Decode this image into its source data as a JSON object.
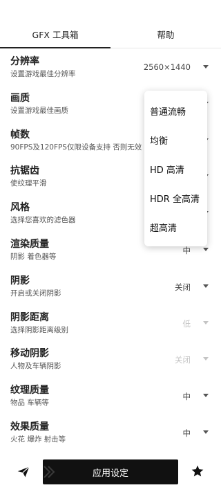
{
  "tabs": [
    {
      "label": "GFX 工具箱",
      "active": true
    },
    {
      "label": "帮助",
      "active": false
    }
  ],
  "settings": [
    {
      "title": "分辨率",
      "desc": "设置游戏最佳分辨率",
      "value": "2560×1440",
      "disabled": false
    },
    {
      "title": "画质",
      "desc": "设置游戏最佳画质",
      "value": "",
      "disabled": false
    },
    {
      "title": "帧数",
      "desc": "90FPS及120FPS仅限设备支持 否则无效",
      "value": "",
      "disabled": false
    },
    {
      "title": "抗锯齿",
      "desc": "使纹理平滑",
      "value": "",
      "disabled": false
    },
    {
      "title": "风格",
      "desc": "选择您喜欢的滤色器",
      "value": "",
      "disabled": false
    },
    {
      "title": "渲染质量",
      "desc": "阴影 着色器等",
      "value": "中",
      "disabled": false
    },
    {
      "title": "阴影",
      "desc": "开启或关闭阴影",
      "value": "关闭",
      "disabled": false
    },
    {
      "title": "阴影距离",
      "desc": "选择阴影距离级别",
      "value": "低",
      "disabled": true
    },
    {
      "title": "移动阴影",
      "desc": "人物及车辆阴影",
      "value": "关闭",
      "disabled": true
    },
    {
      "title": "纹理质量",
      "desc": "物品 车辆等",
      "value": "中",
      "disabled": false
    },
    {
      "title": "效果质量",
      "desc": "火花 爆炸 射击等",
      "value": "中",
      "disabled": false
    }
  ],
  "dropdown": {
    "options": [
      "普通流畅",
      "均衡",
      "HD 高清",
      "HDR 全高清",
      "超高清"
    ]
  },
  "bottom": {
    "apply_label": "应用设定",
    "left_icon": "send-icon",
    "right_icon": "star-icon"
  }
}
